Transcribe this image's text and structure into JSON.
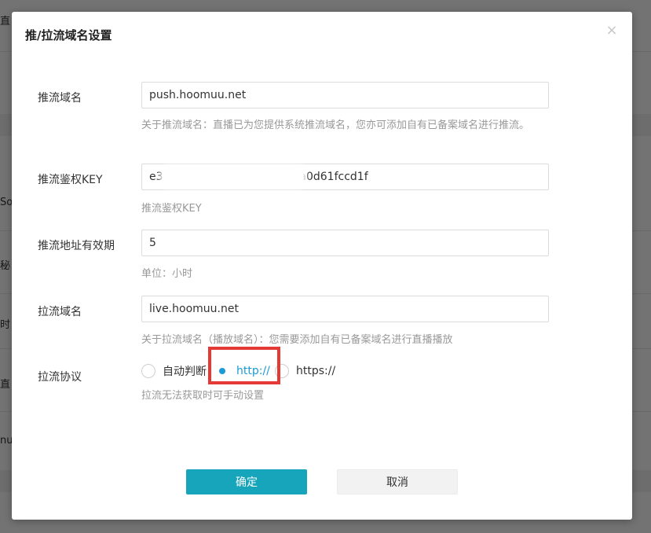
{
  "background": {
    "texts": [
      "直",
      "So",
      "秘",
      "时",
      "直",
      "nu"
    ]
  },
  "modal": {
    "title": "推/拉流域名设置",
    "close_symbol": "×",
    "push_domain": {
      "label": "推流域名",
      "value": "push.hoomuu.net",
      "hint": "关于推流域名：直播已为您提供系统推流域名，您亦可添加自有已备案域名进行推流。"
    },
    "push_key": {
      "label": "推流鉴权KEY",
      "value": "e39a6f79fbf0195fa31c90fea0d61fccd1f",
      "hint": "推流鉴权KEY"
    },
    "push_expiry": {
      "label": "推流地址有效期",
      "value": "5",
      "hint": "单位：小时"
    },
    "pull_domain": {
      "label": "拉流域名",
      "value": "live.hoomuu.net",
      "hint": "关于拉流域名（播放域名）：您需要添加自有已备案域名进行直播播放"
    },
    "pull_protocol": {
      "label": "拉流协议",
      "options": [
        "自动判断",
        "http://",
        "https://"
      ],
      "selected": "http://",
      "hint": "拉流无法获取时可手动设置"
    },
    "buttons": {
      "confirm": "确定",
      "cancel": "取消"
    },
    "colors": {
      "accent": "#17a5bc",
      "radio_selected": "#1a9bd7",
      "highlight": "#e53935"
    }
  }
}
